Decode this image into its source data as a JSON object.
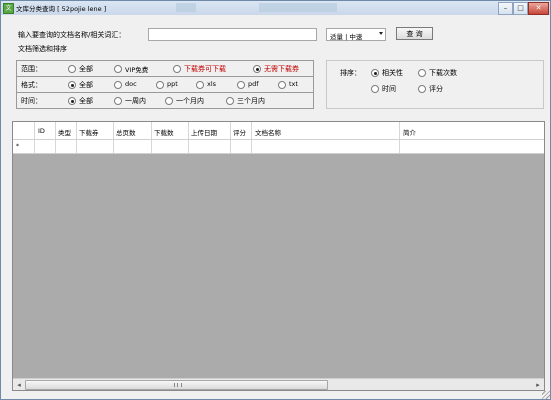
{
  "window": {
    "title": "文库分类查询 [ 52pojie lene ]",
    "icon_letter": "文",
    "controls": {
      "minimize": "–",
      "maximize": "□",
      "close": "✕"
    }
  },
  "query": {
    "prompt_label": "输入要查询的文档名称/相关词汇：",
    "input_value": "",
    "speed_select_value": "适量 | 中速",
    "search_button": "查 询"
  },
  "filter_section_label": "文档筛选和排序",
  "filters": {
    "range": {
      "label": "范围：",
      "options": [
        {
          "label": "全部",
          "checked": false,
          "red": false
        },
        {
          "label": "VIP免费",
          "checked": false,
          "red": false
        },
        {
          "label": "下载券可下载",
          "checked": false,
          "red": true
        },
        {
          "label": "无需下载券",
          "checked": true,
          "red": true
        }
      ]
    },
    "format": {
      "label": "格式：",
      "options": [
        {
          "label": "全部",
          "checked": true
        },
        {
          "label": "doc",
          "checked": false
        },
        {
          "label": "ppt",
          "checked": false
        },
        {
          "label": "xls",
          "checked": false
        },
        {
          "label": "pdf",
          "checked": false
        },
        {
          "label": "txt",
          "checked": false
        }
      ]
    },
    "time": {
      "label": "时间：",
      "options": [
        {
          "label": "全部",
          "checked": true
        },
        {
          "label": "一周内",
          "checked": false
        },
        {
          "label": "一个月内",
          "checked": false
        },
        {
          "label": "三个月内",
          "checked": false
        }
      ]
    }
  },
  "sort": {
    "label": "排序：",
    "options": [
      {
        "label": "相关性",
        "checked": true
      },
      {
        "label": "下载次数",
        "checked": false
      },
      {
        "label": "时间",
        "checked": false
      },
      {
        "label": "评分",
        "checked": false
      }
    ]
  },
  "grid": {
    "columns": [
      "ID",
      "类型",
      "下载券",
      "总页数",
      "下载数",
      "上传日期",
      "评分",
      "文档名称",
      "简介"
    ],
    "new_row_marker": "*",
    "rows": []
  },
  "colors": {
    "accent_red": "#c00000",
    "grid_background": "#ababab",
    "window_background": "#f0f0f0"
  }
}
